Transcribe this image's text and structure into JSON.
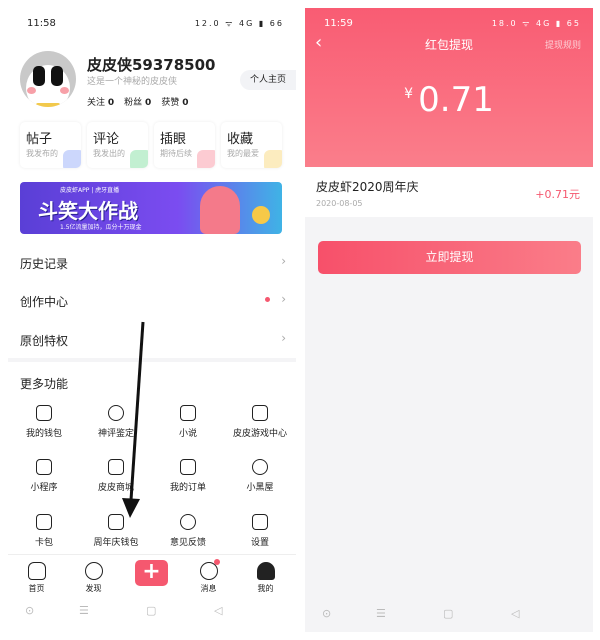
{
  "left": {
    "status": {
      "time": "11:58",
      "icons": "12.0 ᯤ 4G ▮ 66"
    },
    "profile": {
      "name": "皮皮侠59378500",
      "bio": "这是一个神秘的皮皮侠",
      "stats": [
        {
          "label": "关注",
          "value": "0"
        },
        {
          "label": "粉丝",
          "value": "0"
        },
        {
          "label": "获赞",
          "value": "0"
        }
      ],
      "homepage_button": "个人主页"
    },
    "cards": [
      {
        "title": "帖子",
        "sub": "我发布的",
        "color": "#6d8cf5"
      },
      {
        "title": "评论",
        "sub": "我发出的",
        "color": "#4fd07a"
      },
      {
        "title": "插眼",
        "sub": "期待后续",
        "color": "#f56b7d"
      },
      {
        "title": "收藏",
        "sub": "我的最爱",
        "color": "#f7c948"
      }
    ],
    "banner": {
      "title": "斗笑大作战",
      "subtitle": "1.5亿流量加持，瓜分十万现金",
      "logos": "皮皮虾APP | 虎牙直播"
    },
    "menu": [
      {
        "label": "历史记录",
        "dot": false
      },
      {
        "label": "创作中心",
        "dot": true
      },
      {
        "label": "原创特权",
        "dot": false
      }
    ],
    "more": {
      "title": "更多功能",
      "items": [
        {
          "label": "我的钱包",
          "icon": "wallet-icon"
        },
        {
          "label": "神评鉴定",
          "icon": "shen-badge-icon"
        },
        {
          "label": "小说",
          "icon": "book-icon"
        },
        {
          "label": "皮皮游戏中心",
          "icon": "gamepad-icon"
        },
        {
          "label": "小程序",
          "icon": "mini-program-icon"
        },
        {
          "label": "皮皮商城",
          "icon": "store-icon"
        },
        {
          "label": "我的订单",
          "icon": "order-icon"
        },
        {
          "label": "小黑屋",
          "icon": "dizzy-face-icon"
        },
        {
          "label": "卡包",
          "icon": "card-icon"
        },
        {
          "label": "周年庆钱包",
          "icon": "cylinder-wallet-icon"
        },
        {
          "label": "意见反馈",
          "icon": "exclamation-icon"
        },
        {
          "label": "设置",
          "icon": "settings-hexagon-icon"
        }
      ]
    },
    "nav": [
      {
        "label": "首页",
        "icon": "home-icon"
      },
      {
        "label": "发现",
        "icon": "compass-icon"
      },
      {
        "label": "",
        "icon": "plus-icon"
      },
      {
        "label": "消息",
        "icon": "message-icon"
      },
      {
        "label": "我的",
        "icon": "user-icon"
      }
    ],
    "system_nav": [
      "⊙",
      "☰",
      "▢",
      "◁"
    ]
  },
  "right": {
    "status": {
      "time": "11:59",
      "icons": "18.0 ᯤ 4G ▮ 65"
    },
    "header": {
      "back": "‹",
      "title": "红包提现",
      "rules": "提现规则"
    },
    "amount": {
      "currency": "¥",
      "value": "0.71"
    },
    "record": {
      "title": "皮皮虾2020周年庆",
      "date": "2020-08-05",
      "amount": "+0.71元"
    },
    "withdraw_button": "立即提现",
    "system_nav": [
      "⊙",
      "☰",
      "▢",
      "◁"
    ]
  },
  "colors": {
    "accent": "#f5586f",
    "header_top": "#f95c73",
    "header_bottom": "#fa7e8b"
  }
}
